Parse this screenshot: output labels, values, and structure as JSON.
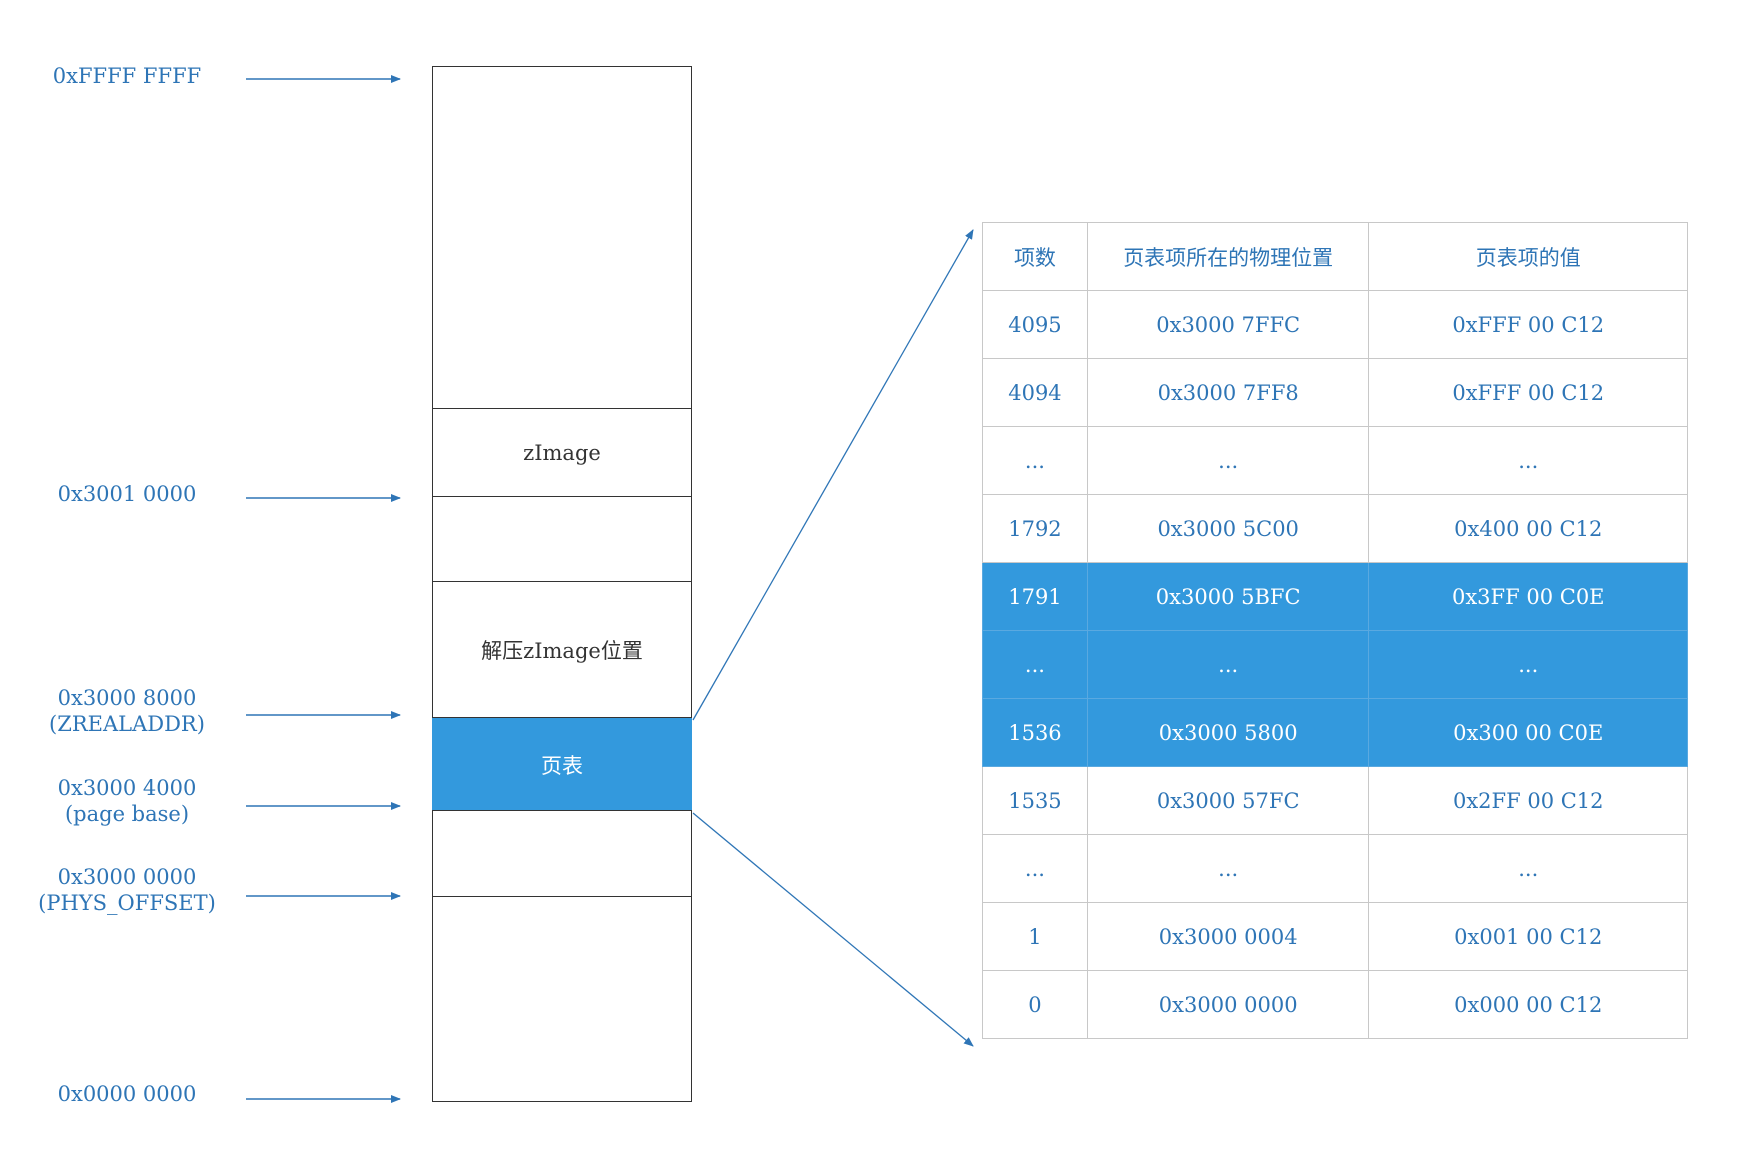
{
  "addresses": {
    "top": {
      "line1": "0xFFFF FFFF",
      "line2": ""
    },
    "zimage": {
      "line1": "0x3001 0000",
      "line2": ""
    },
    "zreal": {
      "line1": "0x3000 8000",
      "line2": "(ZREALADDR)"
    },
    "pagebase": {
      "line1": "0x3000 4000",
      "line2": "(page base)"
    },
    "phys": {
      "line1": "0x3000 0000",
      "line2": "(PHYS_OFFSET)"
    },
    "bottom": {
      "line1": "0x0000 0000",
      "line2": ""
    }
  },
  "memory": {
    "zimage_label": "zImage",
    "decompress_label": "解压zImage位置",
    "page_table_label": "页表"
  },
  "table": {
    "headers": [
      "项数",
      "页表项所在的物理位置",
      "页表项的值"
    ],
    "rows": [
      {
        "index": "4095",
        "location": "0x3000 7FFC",
        "value": "0xFFF 00 C12",
        "highlight": false
      },
      {
        "index": "4094",
        "location": "0x3000 7FF8",
        "value": "0xFFF 00 C12",
        "highlight": false
      },
      {
        "index": "...",
        "location": "...",
        "value": "...",
        "highlight": false
      },
      {
        "index": "1792",
        "location": "0x3000 5C00",
        "value": "0x400 00 C12",
        "highlight": false
      },
      {
        "index": "1791",
        "location": "0x3000 5BFC",
        "value": "0x3FF 00 C0E",
        "highlight": true
      },
      {
        "index": "...",
        "location": "...",
        "value": "...",
        "highlight": true
      },
      {
        "index": "1536",
        "location": "0x3000 5800",
        "value": "0x300 00 C0E",
        "highlight": true
      },
      {
        "index": "1535",
        "location": "0x3000 57FC",
        "value": "0x2FF 00 C12",
        "highlight": false
      },
      {
        "index": "...",
        "location": "...",
        "value": "...",
        "highlight": false
      },
      {
        "index": "1",
        "location": "0x3000 0004",
        "value": "0x001 00 C12",
        "highlight": false
      },
      {
        "index": "0",
        "location": "0x3000 0000",
        "value": "0x000 00 C12",
        "highlight": false
      }
    ]
  },
  "colors": {
    "accent": "#2e75b6",
    "highlight": "#3399dd"
  }
}
